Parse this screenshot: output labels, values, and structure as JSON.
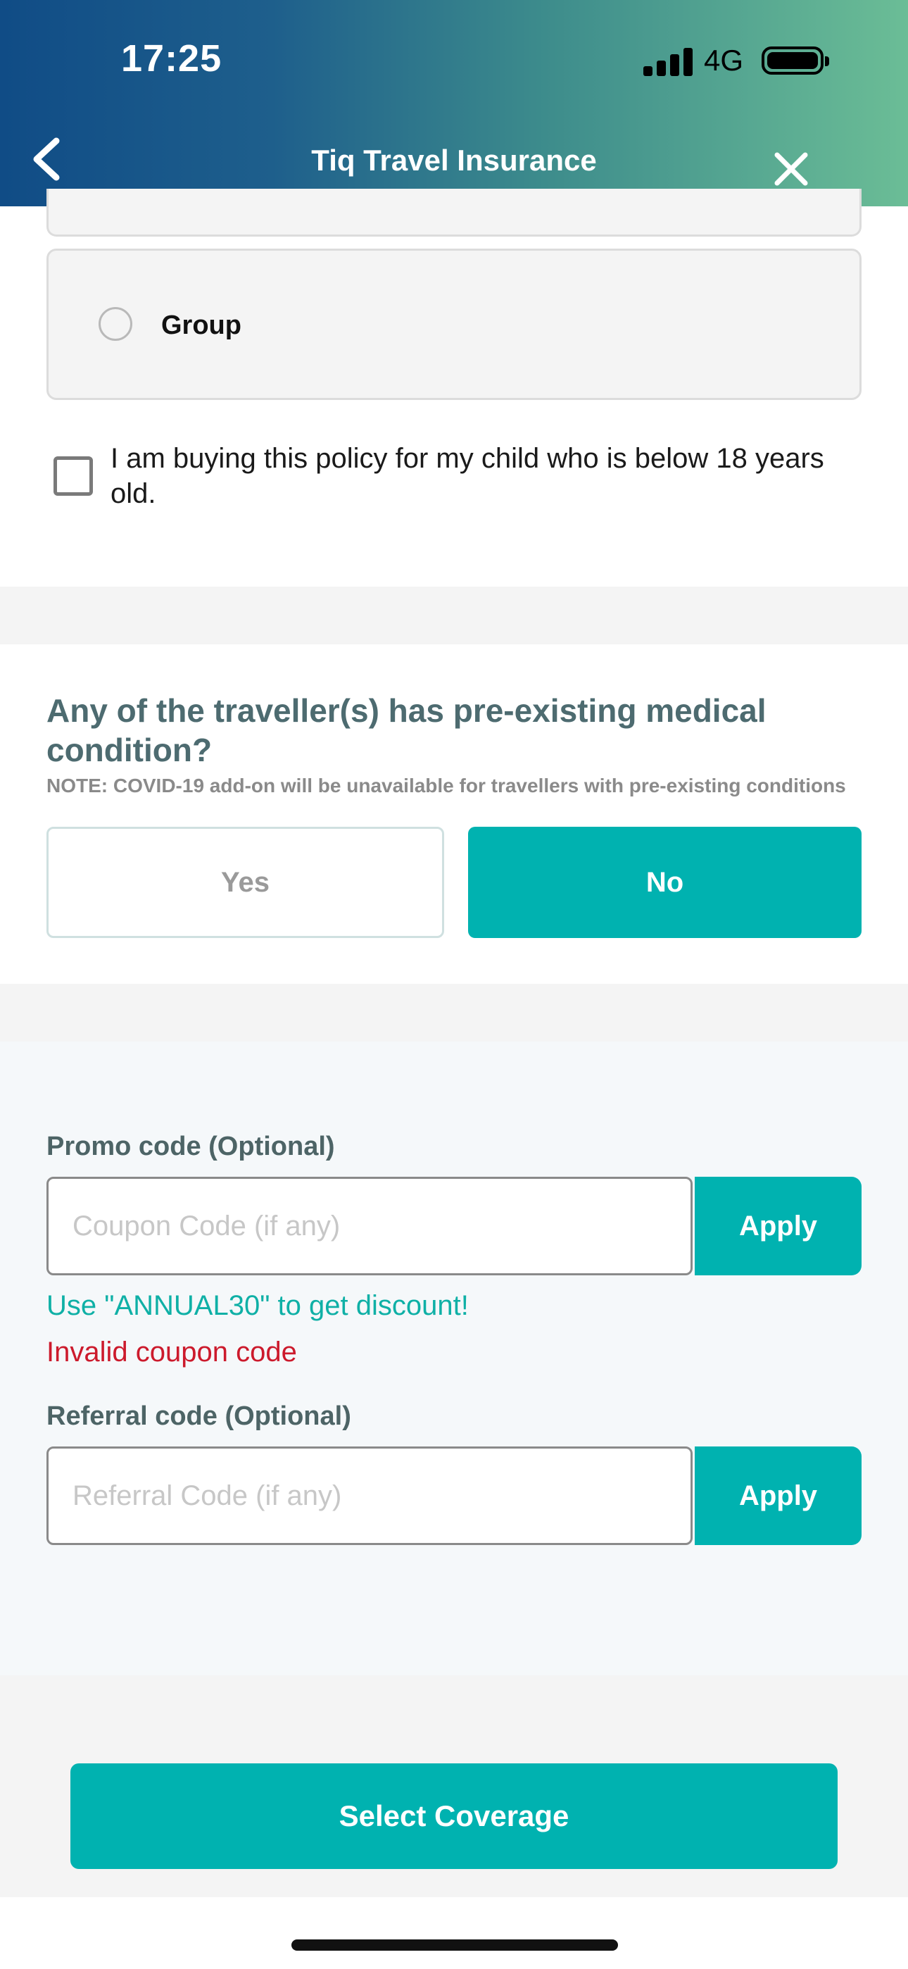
{
  "status_bar": {
    "time": "17:25",
    "network": "4G",
    "icons": [
      "signal-bars-icon",
      "battery-icon"
    ]
  },
  "header": {
    "title": "Tiq Travel Insurance",
    "back_icon": "chevron-left-icon",
    "close_icon": "close-icon"
  },
  "policy_type": {
    "option_label": "Group",
    "selected": false
  },
  "child_policy": {
    "label": "I am buying this policy for my child who is below 18 years old.",
    "checked": false
  },
  "medical": {
    "question": "Any of the traveller(s) has pre-existing medical condition?",
    "note": "NOTE: COVID-19 add-on will be unavailable for travellers with pre-existing conditions",
    "yes_label": "Yes",
    "no_label": "No",
    "selected": "No"
  },
  "promo": {
    "label": "Promo code (Optional)",
    "placeholder": "Coupon Code (if any)",
    "value": "",
    "apply_label": "Apply",
    "hint": "Use \"ANNUAL30\" to get discount!",
    "error": "Invalid coupon code"
  },
  "referral": {
    "label": "Referral code (Optional)",
    "placeholder": "Referral Code (if any)",
    "value": "",
    "apply_label": "Apply"
  },
  "footer": {
    "cta_label": "Select Coverage"
  },
  "colors": {
    "accent": "#00b2b0",
    "heading": "#4d6b70",
    "hint": "#0fb0a6",
    "error": "#cc1a2c"
  }
}
